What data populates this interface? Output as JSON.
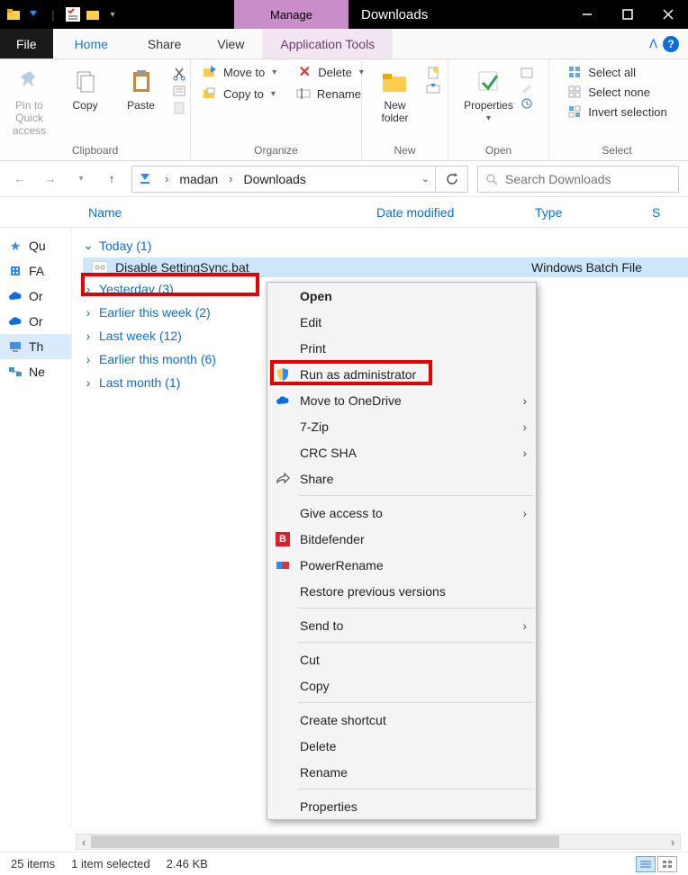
{
  "titlebar": {
    "manage_label": "Manage",
    "title": "Downloads"
  },
  "tabs": {
    "file": "File",
    "home": "Home",
    "share": "Share",
    "view": "View",
    "app_tools": "Application Tools"
  },
  "ribbon": {
    "pin": "Pin to Quick access",
    "copy": "Copy",
    "paste": "Paste",
    "group_clipboard": "Clipboard",
    "moveto": "Move to",
    "copyto": "Copy to",
    "delete": "Delete",
    "rename": "Rename",
    "group_organize": "Organize",
    "newfolder": "New folder",
    "group_new": "New",
    "properties": "Properties",
    "group_open": "Open",
    "selectall": "Select all",
    "selectnone": "Select none",
    "invert": "Invert selection",
    "group_select": "Select"
  },
  "breadcrumb": {
    "seg1": "madan",
    "seg2": "Downloads"
  },
  "search": {
    "placeholder": "Search Downloads"
  },
  "columns": {
    "name": "Name",
    "date": "Date modified",
    "type": "Type",
    "size": "S"
  },
  "nav": {
    "qu": "Qu",
    "fa": "FA",
    "or1": "Or",
    "or2": "Or",
    "th": "Th",
    "ne": "Ne"
  },
  "groups": {
    "today": "Today (1)",
    "yesterday": "Yesterday (3)",
    "thisweek": "Earlier this week (2)",
    "lastweek": "Last week (12)",
    "thismonth": "Earlier this month (6)",
    "lastmonth": "Last month (1)"
  },
  "file": {
    "name": "Disable SettingSync.bat",
    "type": "Windows Batch File"
  },
  "ctx": {
    "open": "Open",
    "edit": "Edit",
    "print": "Print",
    "runadmin": "Run as administrator",
    "onedrive": "Move to OneDrive",
    "sevenzip": "7-Zip",
    "crc": "CRC SHA",
    "share": "Share",
    "giveaccess": "Give access to",
    "bitdefender": "Bitdefender",
    "powerrename": "PowerRename",
    "restore": "Restore previous versions",
    "sendto": "Send to",
    "cut": "Cut",
    "copy": "Copy",
    "shortcut": "Create shortcut",
    "delete": "Delete",
    "rename": "Rename",
    "properties": "Properties"
  },
  "status": {
    "items": "25 items",
    "selected": "1 item selected",
    "size": "2.46 KB"
  }
}
